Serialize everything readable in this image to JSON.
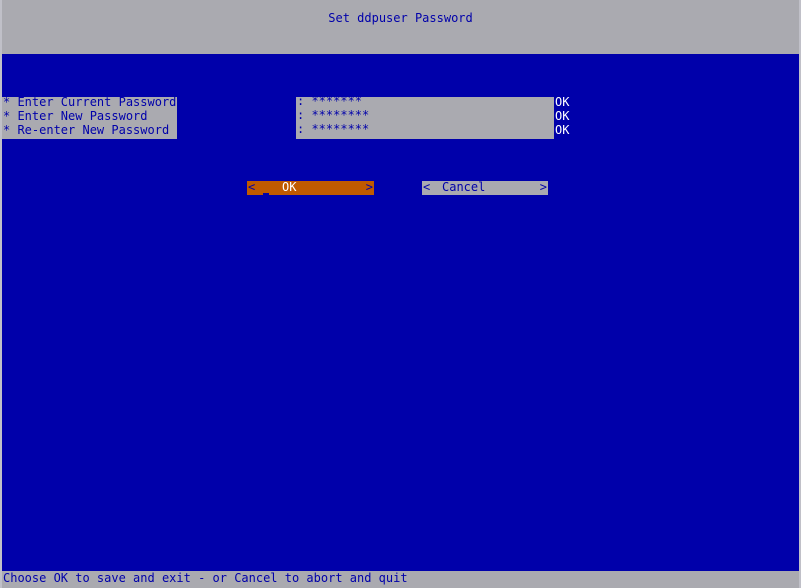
{
  "title": "Set ddpuser Password",
  "fields": [
    {
      "label": "* Enter Current Password",
      "value": ": *******",
      "status": "OK"
    },
    {
      "label": "* Enter New Password",
      "value": ": ********",
      "status": "OK"
    },
    {
      "label": "* Re-enter New Password",
      "value": ": ********",
      "status": "OK"
    }
  ],
  "buttons": {
    "left_bracket": "<",
    "right_bracket": ">",
    "ok_label": "OK",
    "cancel_label": "Cancel"
  },
  "help_text": "Choose OK to save and exit - or Cancel to abort and quit",
  "colors": {
    "background": "#0000aa",
    "panel": "#aaaab0",
    "focus": "#c05a00",
    "text": "#0000aa",
    "status": "#ffffff"
  }
}
